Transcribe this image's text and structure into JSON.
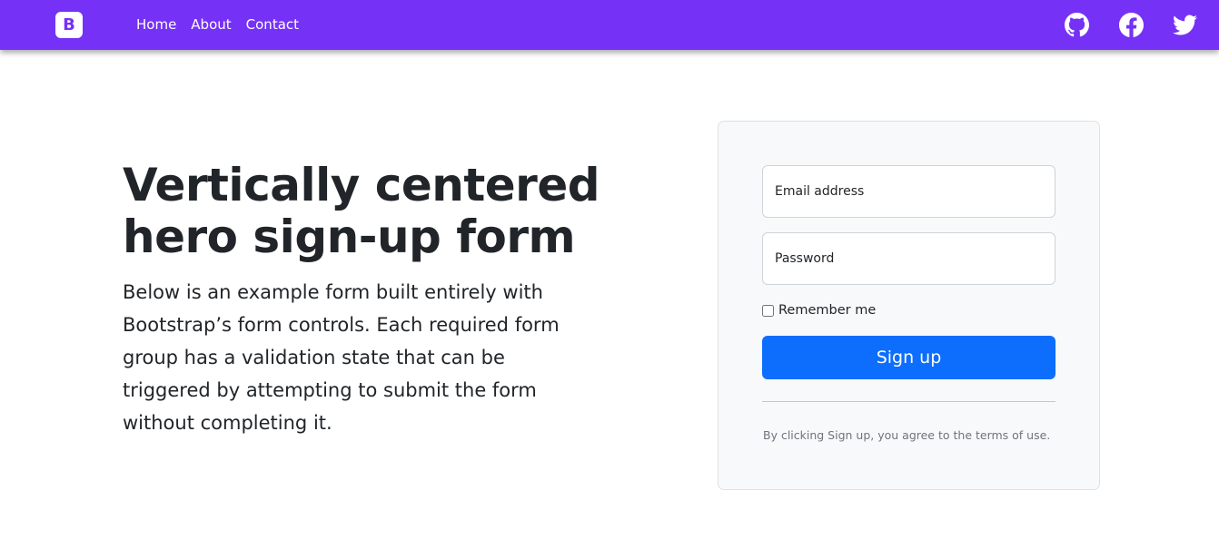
{
  "navbar": {
    "brand_letter": "B",
    "brand_color": "#7631f6",
    "links": [
      {
        "label": "Home"
      },
      {
        "label": "About"
      },
      {
        "label": "Contact"
      }
    ],
    "social_icons": [
      "github-icon",
      "facebook-icon",
      "twitter-icon"
    ]
  },
  "hero": {
    "title": "Vertically centered hero sign-up form",
    "lead": "Below is an example form built entirely with Bootstrap’s form controls. Each required form group has a validation state that can be triggered by attempting to submit the form without completing it."
  },
  "form": {
    "email_placeholder": "Email address",
    "password_placeholder": "Password",
    "remember_label": "Remember me",
    "remember_checked": false,
    "submit_label": "Sign up",
    "terms_text": "By clicking Sign up, you agree to the terms of use.",
    "button_color": "#0d6efd"
  }
}
